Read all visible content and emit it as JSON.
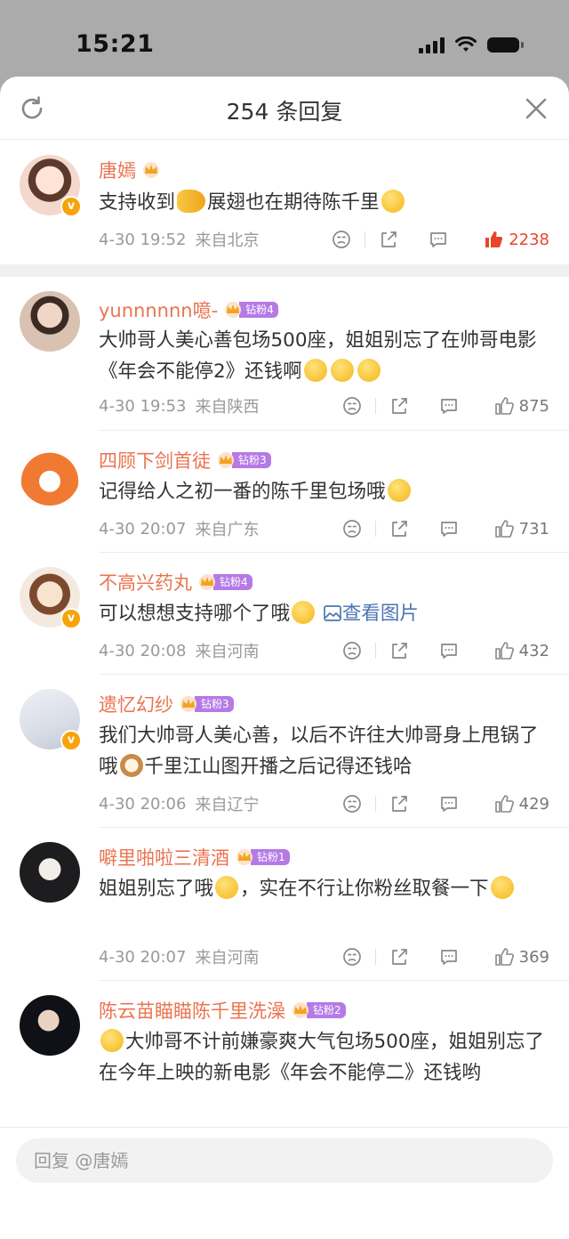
{
  "status": {
    "time": "15:21"
  },
  "header": {
    "title": "254 条回复"
  },
  "reply": {
    "placeholder": "回复 @唐嫣"
  },
  "comments": [
    {
      "user": "唐嫣",
      "badge": "",
      "text_1": "支持收到",
      "text_2": "展翅也在期待陈千里",
      "time": "4-30 19:52",
      "location": "来自北京",
      "likes": "2238"
    },
    {
      "user": "yunnnnnn噫-",
      "badge": "钻粉4",
      "text": "大帅哥人美心善包场500座，姐姐别忘了在帅哥电影《年会不能停2》还钱啊",
      "time": "4-30 19:53",
      "location": "来自陕西",
      "likes": "875"
    },
    {
      "user": "四顾下剑首徒",
      "badge": "钻粉3",
      "text": "记得给人之初一番的陈千里包场哦",
      "time": "4-30 20:07",
      "location": "来自广东",
      "likes": "731"
    },
    {
      "user": "不高兴药丸",
      "badge": "钻粉4",
      "text": "可以想想支持哪个了哦",
      "link": "查看图片",
      "time": "4-30 20:08",
      "location": "来自河南",
      "likes": "432"
    },
    {
      "user": "遗忆幻纱",
      "badge": "钻粉3",
      "text_1": "我们大帅哥人美心善，以后不许往大帅哥身上甩锅了哦",
      "text_2": "千里江山图开播之后记得还钱哈",
      "time": "4-30 20:06",
      "location": "来自辽宁",
      "likes": "429"
    },
    {
      "user": "噼里啪啦三清酒",
      "badge": "钻粉1",
      "text": "姐姐别忘了哦",
      "text_2": "，实在不行让你粉丝取餐一下",
      "time": "4-30 20:07",
      "location": "来自河南",
      "likes": "369"
    },
    {
      "user": "陈云苗瞄瞄陈千里洗澡",
      "badge": "钻粉2",
      "text": "大帅哥不计前嫌豪爽大气包场500座，姐姐别忘了在今年上映的新电影《年会不能停二》还钱哟"
    }
  ],
  "colors": {
    "username": "#eb7350",
    "like_active": "#e8462a",
    "link": "#4a76b3",
    "fan_badge": "#b57ae6"
  }
}
